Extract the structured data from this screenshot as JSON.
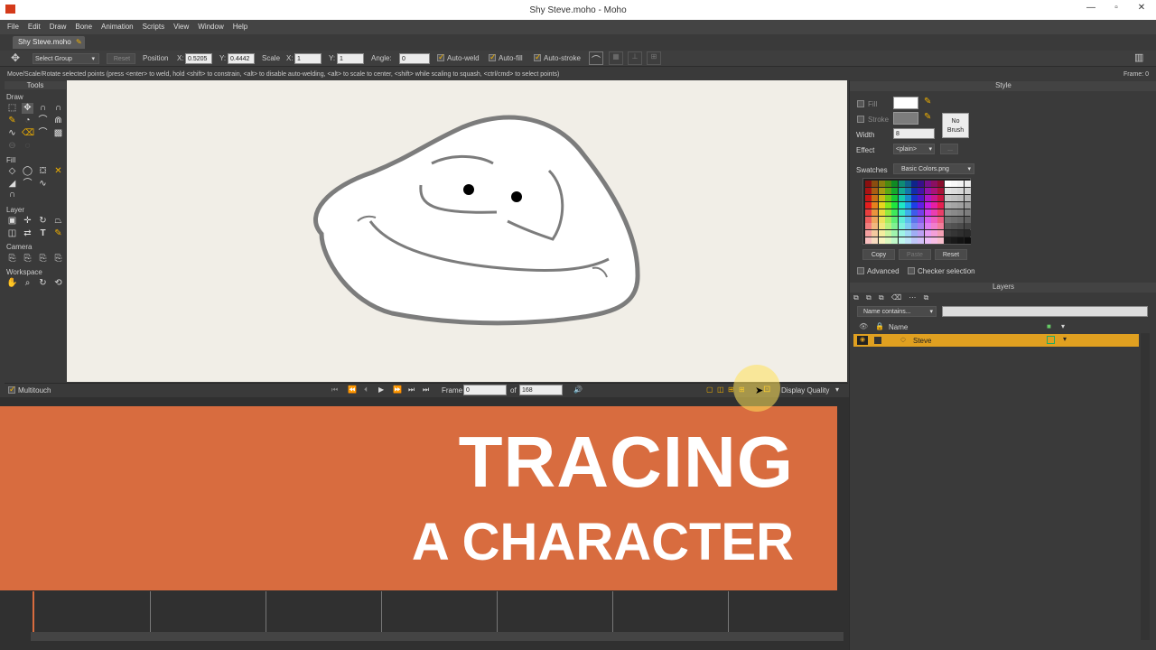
{
  "window": {
    "title": "Shy Steve.moho - Moho"
  },
  "menu": [
    "File",
    "Edit",
    "Draw",
    "Bone",
    "Animation",
    "Scripts",
    "View",
    "Window",
    "Help"
  ],
  "doc_tab": "Shy Steve.moho",
  "tool_options": {
    "select_group": "Select Group",
    "reset": "Reset",
    "position_label": "Position",
    "x_label": "X:",
    "x_value": "0.5205",
    "y_label": "Y:",
    "y_value": "0.4442",
    "scale_label": "Scale",
    "scale_x_label": "X:",
    "scale_x": "1",
    "scale_y_label": "Y:",
    "scale_y": "1",
    "angle_label": "Angle:",
    "angle_value": "0",
    "auto_weld": "Auto-weld",
    "auto_fill": "Auto-fill",
    "auto_stroke": "Auto-stroke"
  },
  "status": {
    "message": "Move/Scale/Rotate selected points (press <enter> to weld, hold <shift> to constrain, <alt> to disable auto-welding, <alt> to scale to center, <shift> while scaling to squash, <ctrl/cmd> to select points)",
    "frame": "Frame: 0"
  },
  "tools": {
    "title": "Tools",
    "sections": [
      "Draw",
      "Fill",
      "Layer",
      "Camera",
      "Workspace"
    ]
  },
  "style": {
    "title": "Style",
    "fill": "Fill",
    "stroke": "Stroke",
    "no_brush": [
      "No",
      "Brush"
    ],
    "width_label": "Width",
    "width_value": "8",
    "effect_label": "Effect",
    "effect_value": "<plain>",
    "swatches_label": "Swatches",
    "swatches_value": "Basic Colors.png",
    "copy": "Copy",
    "paste": "Paste",
    "reset": "Reset",
    "advanced": "Advanced",
    "checker": "Checker selection"
  },
  "layers": {
    "title": "Layers",
    "filter_placeholder": "Name contains...",
    "name_col": "Name",
    "items": [
      {
        "name": "Steve"
      }
    ]
  },
  "playback": {
    "multitouch": "Multitouch",
    "frame_label": "Frame",
    "frame_value": "0",
    "of_label": "of",
    "total": "168",
    "display_quality": "Display Quality"
  },
  "banner": {
    "line1": "TRACING",
    "line2": "A CHARACTER"
  },
  "colors": {
    "accent": "#f0b000",
    "banner": "#d86c3f",
    "canvas": "#f1eee7",
    "layer_sel": "#e0a020"
  }
}
